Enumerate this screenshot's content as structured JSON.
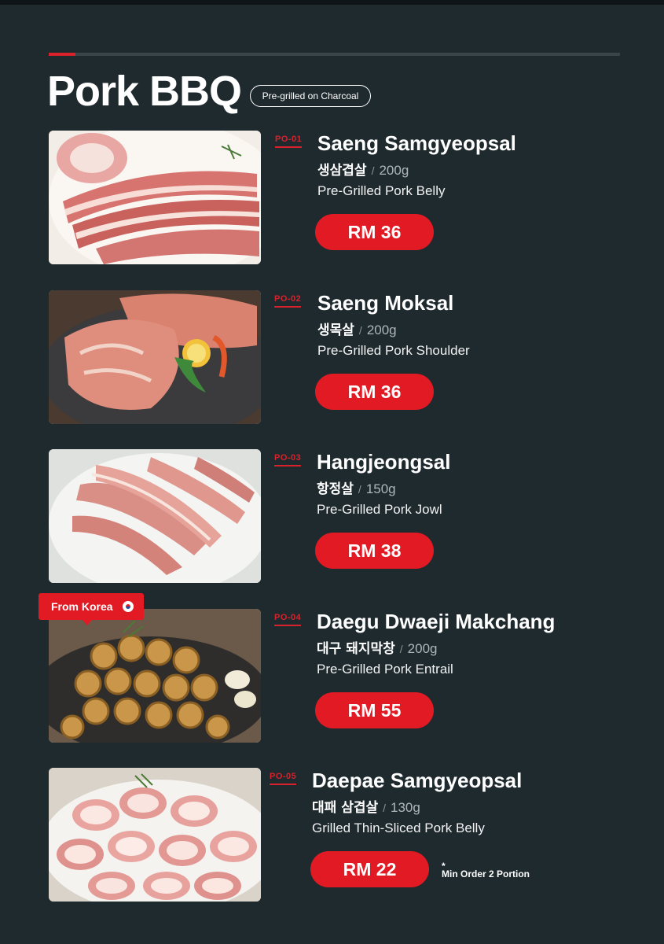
{
  "page": {
    "title": "Pork BBQ",
    "subtitle_pill": "Pre-grilled on Charcoal",
    "colors": {
      "background": "#1f2a2f",
      "accent": "#e21a24",
      "muted": "#aeb6b9"
    }
  },
  "items": [
    {
      "code": "PO-01",
      "name": "Saeng Samgyeopsal",
      "korean": "생삼겹살",
      "weight": "200g",
      "description": "Pre-Grilled Pork Belly",
      "price": "RM 36",
      "image_subject": "raw pork belly slices"
    },
    {
      "code": "PO-02",
      "name": "Saeng Moksal",
      "korean": "생목살",
      "weight": "200g",
      "description": "Pre-Grilled Pork Shoulder",
      "price": "RM 36",
      "image_subject": "raw pork shoulder steaks with lemon and herbs"
    },
    {
      "code": "PO-03",
      "name": "Hangjeongsal",
      "korean": "항정살",
      "weight": "150g",
      "description": "Pre-Grilled Pork Jowl",
      "price": "RM 38",
      "image_subject": "raw pork jowl strips on a white plate"
    },
    {
      "code": "PO-04",
      "name": "Daegu Dwaeji Makchang",
      "korean": "대구 돼지막창",
      "weight": "200g",
      "description": "Pre-Grilled Pork Entrail",
      "price": "RM 55",
      "badge": "From Korea",
      "image_subject": "grilled pork intestine rings with garlic"
    },
    {
      "code": "PO-05",
      "name": "Daepae Samgyeopsal",
      "korean": "대패 삼겹살",
      "weight": "130g",
      "description": "Grilled Thin-Sliced Pork Belly",
      "price": "RM 22",
      "note_mark": "*",
      "note": "Min Order 2 Portion",
      "image_subject": "rolled thin-sliced pork belly"
    }
  ]
}
